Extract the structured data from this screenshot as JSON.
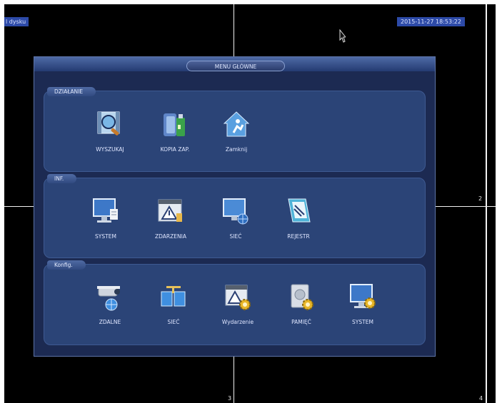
{
  "status": {
    "disk": "l dysku",
    "datetime": "2015-11-27 18:53:22"
  },
  "channels": [
    "2",
    "3",
    "4"
  ],
  "menu": {
    "title": "MENU GŁÓWNE",
    "sections": [
      {
        "label": "DZIAŁANIE",
        "items": [
          {
            "label": "WYSZUKAJ",
            "icon": "search-video-icon"
          },
          {
            "label": "KOPIA ZAP.",
            "icon": "backup-usb-icon"
          },
          {
            "label": "Zamknij",
            "icon": "shutdown-icon"
          }
        ]
      },
      {
        "label": "INF.",
        "items": [
          {
            "label": "SYSTEM",
            "icon": "system-info-icon"
          },
          {
            "label": "ZDARZENIA",
            "icon": "event-warning-icon"
          },
          {
            "label": "SIEĆ",
            "icon": "network-globe-icon"
          },
          {
            "label": "REJESTR",
            "icon": "log-book-icon"
          }
        ]
      },
      {
        "label": "Konfig.",
        "items": [
          {
            "label": "ZDALNE",
            "icon": "remote-camera-icon"
          },
          {
            "label": "SIEĆ",
            "icon": "network-config-icon"
          },
          {
            "label": "Wydarzenie",
            "icon": "event-gear-icon"
          },
          {
            "label": "PAMIĘĆ",
            "icon": "storage-gear-icon"
          },
          {
            "label": "SYSTEM",
            "icon": "system-gear-icon"
          }
        ]
      }
    ]
  },
  "colors": {
    "accent": "#2d4aa8",
    "panel": "#1c2a52",
    "section": "#2b4477"
  }
}
